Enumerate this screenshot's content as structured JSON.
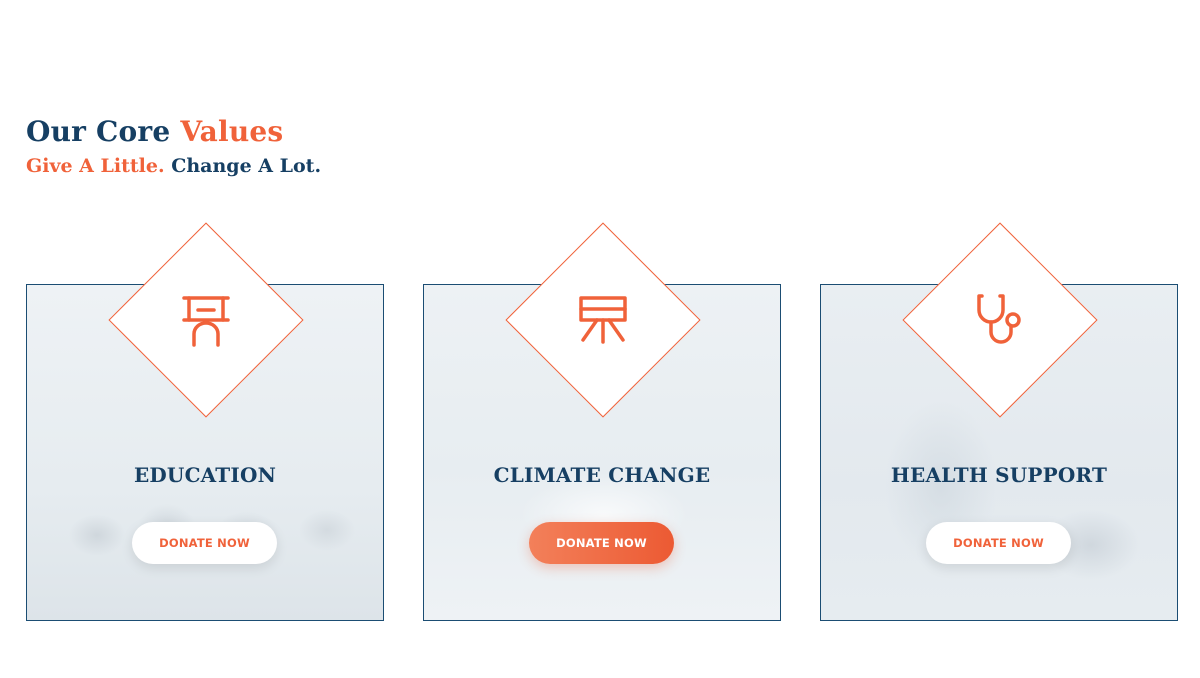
{
  "heading": {
    "title_part1": "Our Core ",
    "title_part2": "Values",
    "subtitle_part1": "Give A Little.",
    "subtitle_part2": " Change A Lot."
  },
  "cards": [
    {
      "title": "EDUCATION",
      "button_label": "DONATE NOW",
      "icon": "graduate-icon",
      "button_style": "light"
    },
    {
      "title": "CLIMATE CHANGE",
      "button_label": "DONATE NOW",
      "icon": "climate-icon",
      "button_style": "primary"
    },
    {
      "title": "HEALTH SUPPORT",
      "button_label": "DONATE NOW",
      "icon": "stethoscope-icon",
      "button_style": "light"
    }
  ],
  "colors": {
    "accent": "#f0623a",
    "navy": "#163f63",
    "card_border": "#1b4d73"
  }
}
